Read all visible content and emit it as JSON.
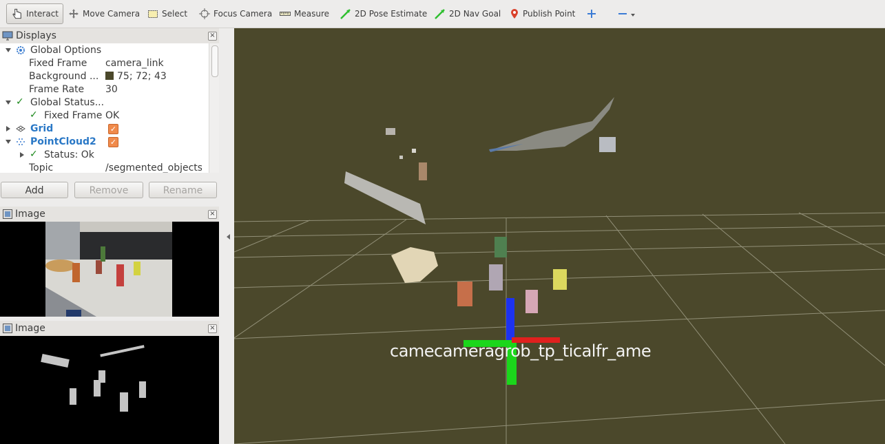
{
  "toolbar": {
    "items": [
      {
        "label": "Interact",
        "icon": "hand-pointer-icon"
      },
      {
        "label": "Move Camera",
        "icon": "move-camera-icon"
      },
      {
        "label": "Select",
        "icon": "select-box-icon"
      },
      {
        "label": "Focus Camera",
        "icon": "focus-crosshair-icon"
      },
      {
        "label": "Measure",
        "icon": "ruler-icon"
      },
      {
        "label": "2D Pose Estimate",
        "icon": "green-arrow-icon"
      },
      {
        "label": "2D Nav Goal",
        "icon": "green-arrow-icon"
      },
      {
        "label": "Publish Point",
        "icon": "map-pin-icon"
      }
    ]
  },
  "displays": {
    "title": "Displays",
    "rows": [
      {
        "label": "Global Options",
        "value": ""
      },
      {
        "label": "Fixed Frame",
        "value": "camera_link"
      },
      {
        "label": "Background ...",
        "value": "75; 72; 43"
      },
      {
        "label": "Frame Rate",
        "value": "30"
      },
      {
        "label": "Global Status...",
        "value": ""
      },
      {
        "label": "Fixed Frame",
        "value": "OK"
      },
      {
        "label": "Grid",
        "value": ""
      },
      {
        "label": "PointCloud2",
        "value": ""
      },
      {
        "label": "Status: Ok",
        "value": ""
      },
      {
        "label": "Topic",
        "value": "/segmented_objects"
      }
    ],
    "buttons": {
      "add": "Add",
      "remove": "Remove",
      "rename": "Rename"
    }
  },
  "image_panel_1": {
    "title": "Image"
  },
  "image_panel_2": {
    "title": "Image"
  },
  "viewport": {
    "background_color": "#4b482b",
    "frame_label": "camecameragrob_tp_ticalfr_ame"
  },
  "colors": {
    "accent_blue": "#2a78c6",
    "checkbox_orange": "#f08a4b",
    "ok_green": "#1e8a1e"
  }
}
